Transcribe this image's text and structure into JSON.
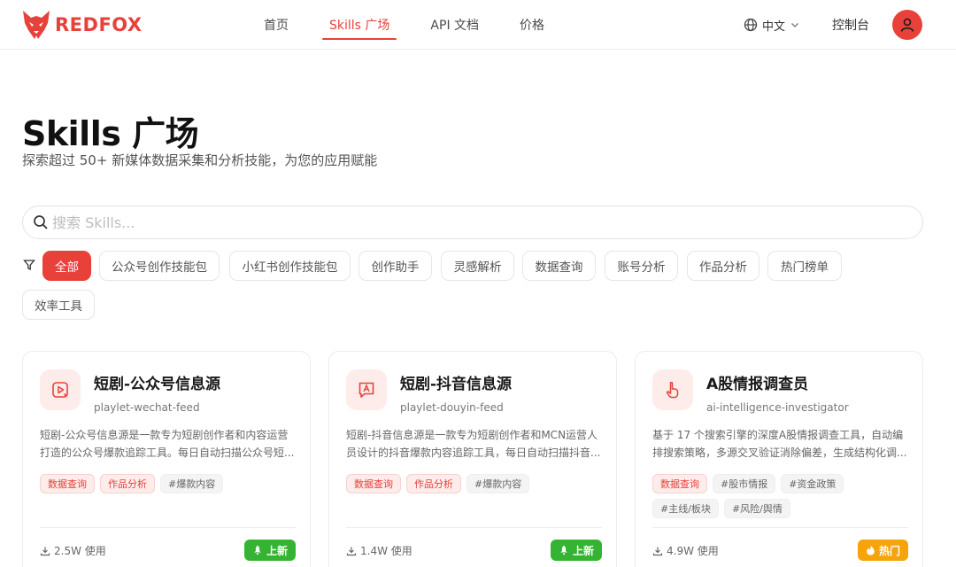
{
  "brand": {
    "name": "REDFOX",
    "color": "#e8413a"
  },
  "nav": {
    "items": [
      "首页",
      "Skills 广场",
      "API 文档",
      "价格"
    ],
    "active_index": 1
  },
  "header": {
    "language": "中文",
    "console": "控制台",
    "language_icon": "globe-icon",
    "avatar_icon": "user-icon"
  },
  "hero": {
    "title": "Skills 广场",
    "subtitle": "探索超过 50+ 新媒体数据采集和分析技能，为您的应用赋能"
  },
  "search": {
    "placeholder": "搜索 Skills...",
    "value": ""
  },
  "filters": {
    "icon": "filter-icon",
    "active": "全部",
    "items": [
      "全部",
      "公众号创作技能包",
      "小红书创作技能包",
      "创作助手",
      "灵感解析",
      "数据查询",
      "账号分析",
      "作品分析",
      "热门榜单",
      "效率工具"
    ]
  },
  "cards": [
    {
      "icon": "play-icon",
      "title": "短剧-公众号信息源",
      "slug": "playlet-wechat-feed",
      "description": "短剧-公众号信息源是一款专为短剧创作者和内容运营打造的公众号爆款追踪工具。每日自动扫描公众号短...",
      "tags": [
        {
          "label": "数据查询",
          "style": "red"
        },
        {
          "label": "作品分析",
          "style": "red"
        },
        {
          "label": "#爆款内容",
          "style": "gray"
        }
      ],
      "usage": "2.5W 使用",
      "badge": {
        "label": "上新",
        "color": "#35b434",
        "icon": "rocket-icon"
      }
    },
    {
      "icon": "text-a-icon",
      "title": "短剧-抖音信息源",
      "slug": "playlet-douyin-feed",
      "description": "短剧-抖音信息源是一款专为短剧创作者和MCN运营人员设计的抖音爆款内容追踪工具，每日自动扫描抖音...",
      "tags": [
        {
          "label": "数据查询",
          "style": "red"
        },
        {
          "label": "作品分析",
          "style": "red"
        },
        {
          "label": "#爆款内容",
          "style": "gray"
        }
      ],
      "usage": "1.4W 使用",
      "badge": {
        "label": "上新",
        "color": "#35b434",
        "icon": "rocket-icon"
      }
    },
    {
      "icon": "pointer-icon",
      "title": "A股情报调查员",
      "slug": "ai-intelligence-investigator",
      "description": "基于 17 个搜索引擎的深度A股情报调查工具，自动编排搜索策略，多源交叉验证消除偏差，生成结构化调...",
      "tags": [
        {
          "label": "数据查询",
          "style": "red"
        },
        {
          "label": "#股市情报",
          "style": "gray"
        },
        {
          "label": "#资金政策",
          "style": "gray"
        },
        {
          "label": "#主线/板块",
          "style": "gray"
        },
        {
          "label": "#风险/舆情",
          "style": "gray"
        }
      ],
      "usage": "4.9W 使用",
      "badge": {
        "label": "热门",
        "color": "#f5a40b",
        "icon": "flame-icon"
      }
    }
  ]
}
